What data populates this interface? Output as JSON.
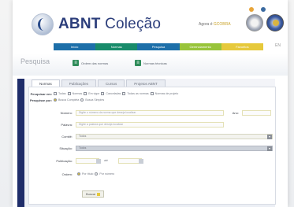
{
  "header": {
    "brand_part1": "ABNT",
    "brand_part2": "Coleção",
    "greeting": "Agora é",
    "greeting_user": "GCOBRA"
  },
  "nav": {
    "items": [
      {
        "label": "Início",
        "color": "#1d6fa9"
      },
      {
        "label": "Normas",
        "color": "#188b6a"
      },
      {
        "label": "Pesquisa",
        "color": "#1d6fa9"
      },
      {
        "label": "Gerenciamento",
        "color": "#98c43a"
      },
      {
        "label": "Favoritos",
        "color": "#e6c93b"
      }
    ],
    "extra_label": "EN"
  },
  "page": {
    "title": "Pesquisa",
    "quick_links": [
      {
        "label": "Ordem das normas"
      },
      {
        "label": "Normas técnicas"
      }
    ]
  },
  "tabs": [
    {
      "label": "Normas",
      "active": true
    },
    {
      "label": "Publicações",
      "active": false
    },
    {
      "label": "Cursos",
      "active": false
    },
    {
      "label": "Projetos ABNT",
      "active": false
    }
  ],
  "form": {
    "search_in_label": "Pesquisar em:",
    "search_in_options": [
      "Todas",
      "Normas",
      "Em vigor",
      "Canceladas",
      "Todas as normas",
      "Normas de projeto"
    ],
    "search_by_label": "Pesquisar por:",
    "search_by_options": [
      "Busca Completa",
      "Busca Simples"
    ],
    "number_label": "Número:",
    "number_placeholder": "Digite o número da norma que deseja localizar",
    "year_label": "Ano:",
    "title_label": "Palavra:",
    "title_placeholder": "Digite a palavra que deseja localizar",
    "committee_label": "Comitê:",
    "committee_value": "Todos",
    "status_label": "Situação:",
    "status_value": "Todos",
    "date_label": "Publicação:",
    "date_separator": "até",
    "order_label": "Ordem:",
    "order_option": "Por título",
    "order_option2": "Por número",
    "submit_label": "Buscar"
  }
}
